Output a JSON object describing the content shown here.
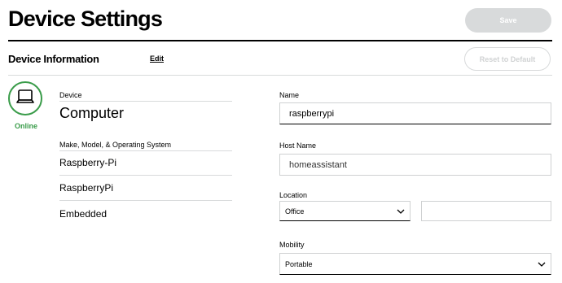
{
  "header": {
    "title": "Device Settings",
    "save_label": "Save"
  },
  "section": {
    "title": "Device Information",
    "edit_label": "Edit",
    "reset_label": "Reset to Default"
  },
  "status": {
    "text": "Online",
    "icon": "laptop-icon",
    "color": "#3a9c4a"
  },
  "device": {
    "label": "Device",
    "type": "Computer",
    "mmo_label": "Make, Model, & Operating System",
    "make": "Raspberry-Pi",
    "model": "RaspberryPi",
    "os": "Embedded"
  },
  "form": {
    "name_label": "Name",
    "name_value": "raspberrypi",
    "host_label": "Host Name",
    "host_value": "homeassistant",
    "location_label": "Location",
    "location_value": "Office",
    "location_extra_value": "",
    "mobility_label": "Mobility",
    "mobility_value": "Portable"
  }
}
